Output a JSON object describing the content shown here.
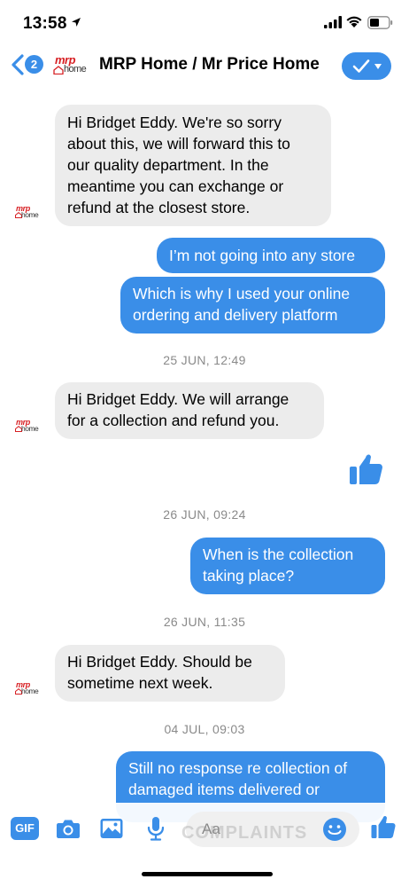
{
  "status_bar": {
    "time": "13:58"
  },
  "header": {
    "back_count": "2",
    "logo_mrp": "mrp",
    "logo_home": "home",
    "title": "MRP Home / Mr Price Home"
  },
  "messages": [
    {
      "type": "incoming",
      "text": "Hi Bridget Eddy. We're so sorry\nabout this, we will forward this to\nour quality department. In the\nmeantime you can exchange or\nrefund at the closest store."
    },
    {
      "type": "outgoing",
      "text": "I’m not going into any store"
    },
    {
      "type": "outgoing",
      "text": "Which is why I used your online\nordering and delivery platform"
    },
    {
      "type": "timestamp",
      "text": "25 JUN, 12:49"
    },
    {
      "type": "incoming",
      "text": "Hi Bridget Eddy. We will arrange\nfor a collection and refund you."
    },
    {
      "type": "like",
      "icon": "thumbs-up-icon"
    },
    {
      "type": "timestamp",
      "text": "26 JUN, 09:24"
    },
    {
      "type": "outgoing",
      "text": "When is the collection\ntaking place?"
    },
    {
      "type": "timestamp",
      "text": "26 JUN, 11:35"
    },
    {
      "type": "incoming",
      "text": "Hi Bridget Eddy. Should be\nsometime next week."
    },
    {
      "type": "timestamp",
      "text": "04 JUL, 09:03"
    },
    {
      "type": "outgoing",
      "text": "Still no response re collection of\ndamaged items delivered or"
    }
  ],
  "composer": {
    "gif_label": "GIF",
    "placeholder": "Aa"
  },
  "watermark": "COMPLAINTS",
  "colors": {
    "accent": "#3a8ee8",
    "incoming_bubble": "#ececec",
    "brand_red": "#d72024"
  }
}
